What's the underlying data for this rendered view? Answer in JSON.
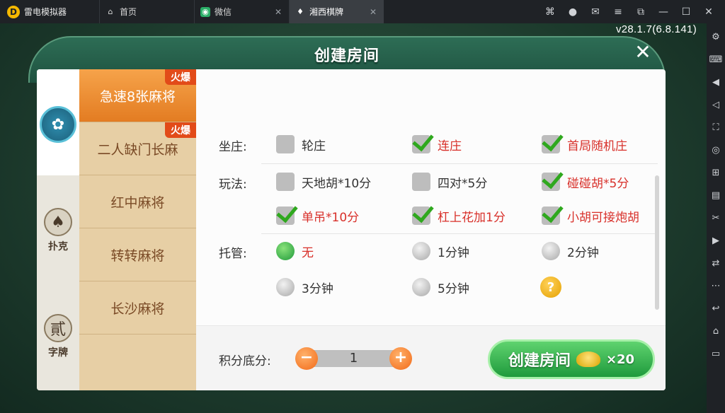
{
  "window": {
    "app_name": "雷电模拟器",
    "tabs": [
      {
        "label": "首页"
      },
      {
        "label": "微信"
      },
      {
        "label": "湘西棋牌"
      }
    ]
  },
  "game": {
    "version": "v28.1.7(6.8.141)",
    "dialog": {
      "title": "创建房间",
      "categories": [
        {
          "label": ""
        },
        {
          "label": "扑克"
        },
        {
          "label": "字牌"
        }
      ],
      "games": [
        {
          "label": "急速8张麻将",
          "badge": "火爆"
        },
        {
          "label": "二人缺门长麻",
          "badge": "火爆"
        },
        {
          "label": "红中麻将"
        },
        {
          "label": "转转麻将"
        },
        {
          "label": "长沙麻将"
        }
      ],
      "sections": {
        "zuozhuang": {
          "label": "坐庄:",
          "options": [
            {
              "label": "轮庄",
              "checked": false
            },
            {
              "label": "连庄",
              "checked": true
            },
            {
              "label": "首局随机庄",
              "checked": true
            }
          ]
        },
        "wanfa": {
          "label": "玩法:",
          "options": [
            {
              "label": "天地胡*10分",
              "checked": false
            },
            {
              "label": "四对*5分",
              "checked": false
            },
            {
              "label": "碰碰胡*5分",
              "checked": true
            },
            {
              "label": "单吊*10分",
              "checked": true
            },
            {
              "label": "杠上花加1分",
              "checked": true
            },
            {
              "label": "小胡可接炮胡",
              "checked": true
            }
          ]
        },
        "tuoguan": {
          "label": "托管:",
          "options": [
            {
              "label": "无",
              "selected": true
            },
            {
              "label": "1分钟",
              "selected": false
            },
            {
              "label": "2分钟",
              "selected": false
            },
            {
              "label": "3分钟",
              "selected": false
            },
            {
              "label": "5分钟",
              "selected": false
            }
          ],
          "help": "?"
        }
      },
      "score": {
        "label": "积分底分:",
        "value": "1"
      },
      "create_button": {
        "label": "创建房间",
        "cost": "×20"
      }
    }
  }
}
